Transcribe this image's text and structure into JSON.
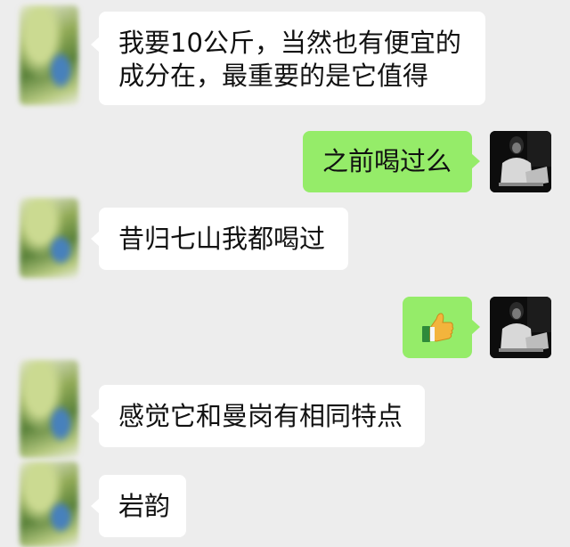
{
  "colors": {
    "background": "#ededed",
    "incoming_bubble": "#ffffff",
    "outgoing_bubble": "#95ec69"
  },
  "messages": [
    {
      "side": "left",
      "lines": [
        "我要10公斤，当然也有便宜的",
        "成分在，最重要的是它值得"
      ]
    },
    {
      "side": "right",
      "lines": [
        "之前喝过么"
      ]
    },
    {
      "side": "left",
      "lines": [
        "昔归七山我都喝过"
      ]
    },
    {
      "side": "right",
      "emoji": "thumbs-up-icon"
    },
    {
      "side": "left",
      "lines": [
        "感觉它和曼岗有相同特点"
      ]
    },
    {
      "side": "left",
      "lines": [
        "岩韵"
      ]
    }
  ]
}
